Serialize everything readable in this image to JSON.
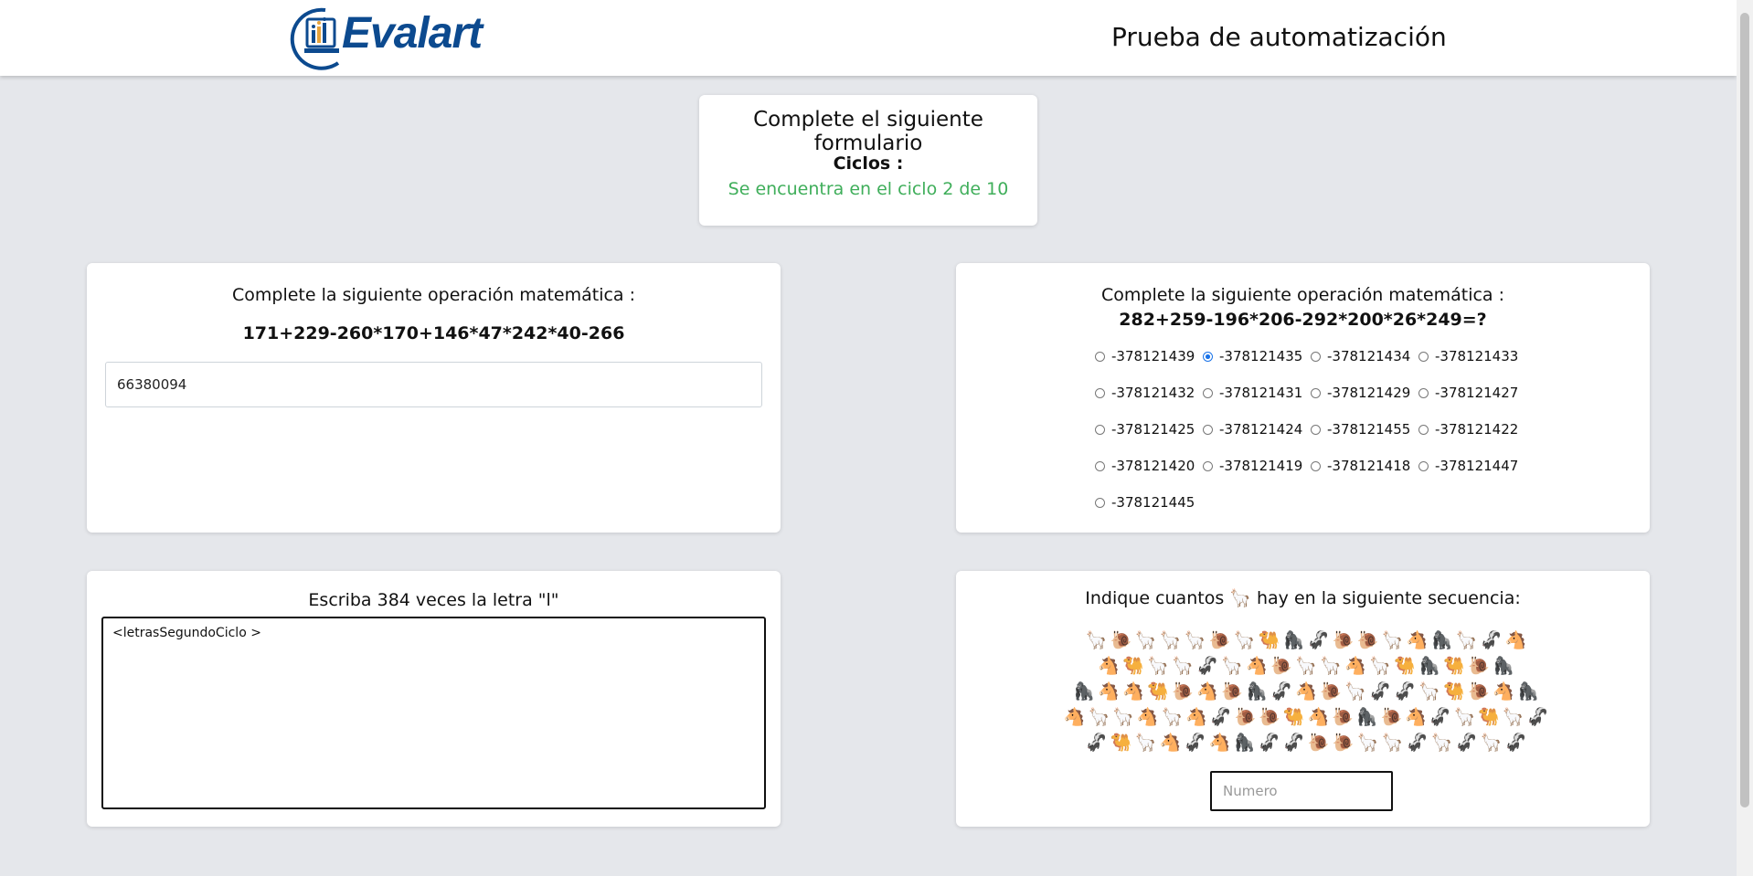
{
  "header": {
    "logo_text": "Evalart",
    "title": "Prueba de automatización"
  },
  "cycle": {
    "title": "Complete el siguiente formulario",
    "label": "Ciclos :",
    "status": "Se encuentra en el ciclo 2 de 10"
  },
  "math_input": {
    "title": "Complete la siguiente operación matemática :",
    "operation": "171+229-260*170+146*47*242*40-266",
    "value": "66380094"
  },
  "math_choice": {
    "title": "Complete la siguiente operación matemática :",
    "operation": "282+259-196*206-292*200*26*249=?",
    "selected": "-378121435",
    "options": [
      "-378121439",
      "-378121435",
      "-378121434",
      "-378121433",
      "-378121432",
      "-378121431",
      "-378121429",
      "-378121427",
      "-378121425",
      "-378121424",
      "-378121455",
      "-378121422",
      "-378121420",
      "-378121419",
      "-378121418",
      "-378121447",
      "-378121445"
    ]
  },
  "letters": {
    "title": "Escriba 384 veces la letra \"l\"",
    "value": "<letrasSegundoCiclo >"
  },
  "animals": {
    "title_prefix": "Indique cuantos",
    "title_icon": "🦙",
    "title_suffix": "hay en la siguiente secuencia:",
    "placeholder": "Numero",
    "rows": [
      [
        "🦙",
        "🐌",
        "🦙",
        "🦙",
        "🦙",
        "🐌",
        "🦙",
        "🐫",
        "🦍",
        "🦨",
        "🐌",
        "🐌",
        "🦙",
        "🐴",
        "🦍",
        "🦙",
        "🦨",
        "🐴"
      ],
      [
        "🐴",
        "🐫",
        "🦙",
        "🦙",
        "🦨",
        "🦙",
        "🐴",
        "🐌",
        "🦙",
        "🦙",
        "🐴",
        "🦙",
        "🐫",
        "🦍",
        "🐫",
        "🐌",
        "🦍"
      ],
      [
        "🦍",
        "🐴",
        "🐴",
        "🐫",
        "🐌",
        "🐴",
        "🐌",
        "🦍",
        "🦨",
        "🐴",
        "🐌",
        "🦙",
        "🦨",
        "🦨",
        "🦙",
        "🐫",
        "🐌",
        "🐴",
        "🦍"
      ],
      [
        "🐴",
        "🦙",
        "🦙",
        "🐴",
        "🦙",
        "🐴",
        "🦨",
        "🐌",
        "🐌",
        "🐫",
        "🐴",
        "🐌",
        "🦍",
        "🐌",
        "🐴",
        "🦨",
        "🦙",
        "🐫",
        "🦙",
        "🦨"
      ],
      [
        "🦨",
        "🐫",
        "🦙",
        "🐴",
        "🦨",
        "🐴",
        "🦍",
        "🦨",
        "🦨",
        "🐌",
        "🐌",
        "🦙",
        "🦙",
        "🦨",
        "🦙",
        "🦨",
        "🦙",
        "🦨"
      ]
    ]
  }
}
